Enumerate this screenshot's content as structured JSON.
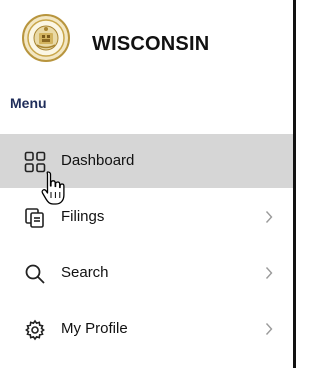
{
  "brand": {
    "name": "WISCONSIN",
    "seal_icon": "state-seal-icon"
  },
  "menu": {
    "heading": "Menu",
    "items": [
      {
        "label": "Dashboard",
        "icon": "grid-icon",
        "active": true,
        "has_submenu": false
      },
      {
        "label": "Filings",
        "icon": "documents-icon",
        "active": false,
        "has_submenu": true
      },
      {
        "label": "Search",
        "icon": "search-icon",
        "active": false,
        "has_submenu": true
      },
      {
        "label": "My Profile",
        "icon": "gear-icon",
        "active": false,
        "has_submenu": true
      }
    ]
  },
  "colors": {
    "active_bg": "#d6d6d6",
    "heading": "#1f2d5a",
    "seal_gold": "#c9a64a"
  }
}
